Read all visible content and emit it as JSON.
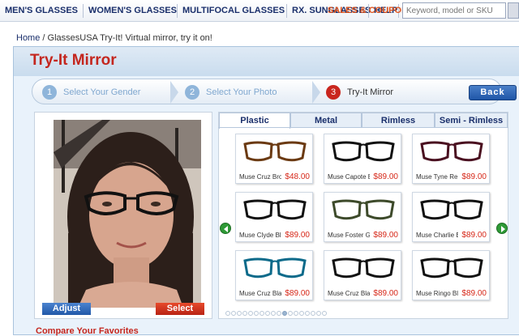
{
  "nav": {
    "items": [
      "MEN'S GLASSES",
      "WOMEN'S GLASSES",
      "MULTIFOCAL GLASSES",
      "RX. SUNGLASSES",
      "HELP"
    ],
    "sales": "SALES & COUPONS",
    "search_placeholder": "Keyword, model or SKU"
  },
  "breadcrumb": {
    "home": "Home",
    "sep": " / ",
    "current": "GlassesUSA Try-It! Virtual mirror, try it on!"
  },
  "page_title": "Try-It Mirror",
  "steps": [
    {
      "num": "1",
      "label": "Select Your Gender"
    },
    {
      "num": "2",
      "label": "Select Your Photo"
    },
    {
      "num": "3",
      "label": "Try-It Mirror"
    }
  ],
  "back_label": "Back",
  "photo": {
    "adjust_label": "Adjust",
    "select_label": "Select"
  },
  "tabs": [
    "Plastic",
    "Metal",
    "Rimless",
    "Semi - Rimless"
  ],
  "frames": [
    {
      "name": "Muse Cruz Bro...",
      "price": "$48.00",
      "color": "#6b3a12"
    },
    {
      "name": "Muse Capote B...",
      "price": "$89.00",
      "color": "#111111"
    },
    {
      "name": "Muse Tyne Re...",
      "price": "$89.00",
      "color": "#4a1020"
    },
    {
      "name": "Muse Clyde Bl...",
      "price": "$89.00",
      "color": "#111111"
    },
    {
      "name": "Muse Foster Gr...",
      "price": "$89.00",
      "color": "#3d4a2a"
    },
    {
      "name": "Muse Charlie B...",
      "price": "$89.00",
      "color": "#111111"
    },
    {
      "name": "Muse Cruz Bla...",
      "price": "$89.00",
      "color": "#0c6a8a"
    },
    {
      "name": "Muse Cruz Bla...",
      "price": "$89.00",
      "color": "#111111"
    },
    {
      "name": "Muse Ringo Bl...",
      "price": "$89.00",
      "color": "#111111"
    }
  ],
  "pagination": {
    "pages": 18,
    "active_page": 11
  },
  "compare_label": "Compare Your Favorites",
  "colors": {
    "accent_red": "#c4261e",
    "nav_blue": "#1a2f6b",
    "sales_orange": "#e0531c",
    "price_red": "#d62718"
  }
}
